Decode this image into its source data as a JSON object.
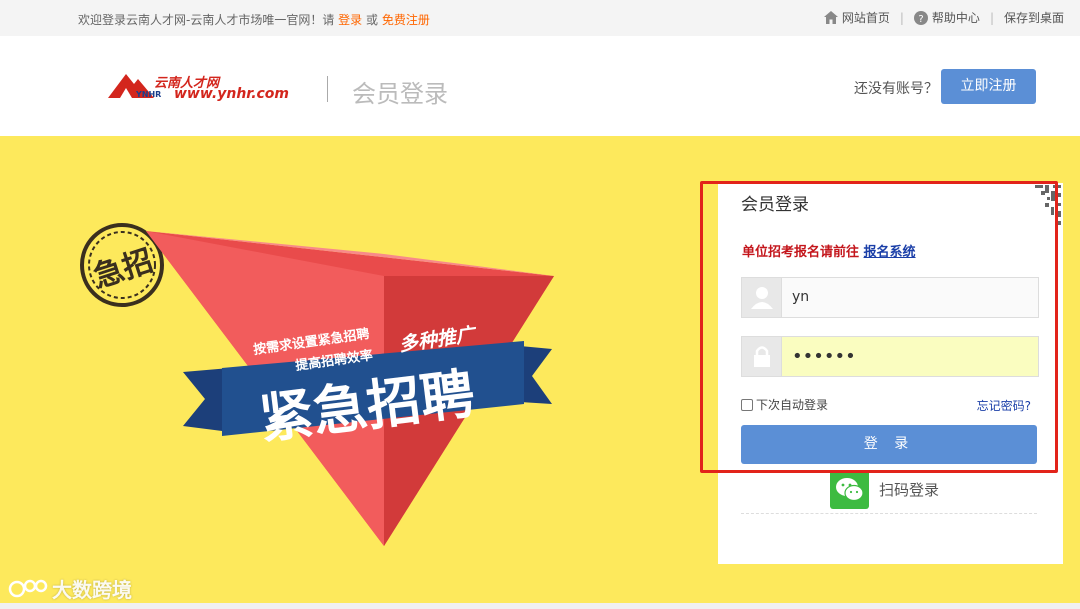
{
  "topbar": {
    "welcome_text": "欢迎登录云南人才网-云南人才市场唯一官网！请",
    "login_link": "登录",
    "or_text": "或",
    "register_link": "免费注册",
    "home_link": "网站首页",
    "help_link": "帮助中心",
    "desktop_link": "保存到桌面"
  },
  "header": {
    "logo_cn": "云南人才网",
    "logo_url": "www.ynhr.com",
    "logo_abbr": "YNHR",
    "title": "会员登录",
    "no_account_text": "还没有账号？",
    "register_button": "立即注册"
  },
  "banner": {
    "stamp_text": "急招",
    "slogan_line1": "按需求设置紧急招聘",
    "slogan_line2": "提高招聘效率",
    "promo_text": "多种推广",
    "main_text": "紧急招聘"
  },
  "login": {
    "title": "会员登录",
    "notice_text": "单位招考报名请前往",
    "notice_link": "报名系统",
    "username_value": "yn",
    "password_value": "••••••",
    "remember_label": "下次自动登录",
    "forgot_label": "忘记密码?",
    "login_button": "登 录",
    "scan_label": "扫码登录"
  },
  "watermark": {
    "text": "大数跨境"
  },
  "colors": {
    "banner_bg": "#fde95c",
    "accent_blue": "#5b8fd6",
    "brand_red": "#d3261d",
    "highlight_red": "#e2231a",
    "wechat_green": "#3dbb41"
  }
}
